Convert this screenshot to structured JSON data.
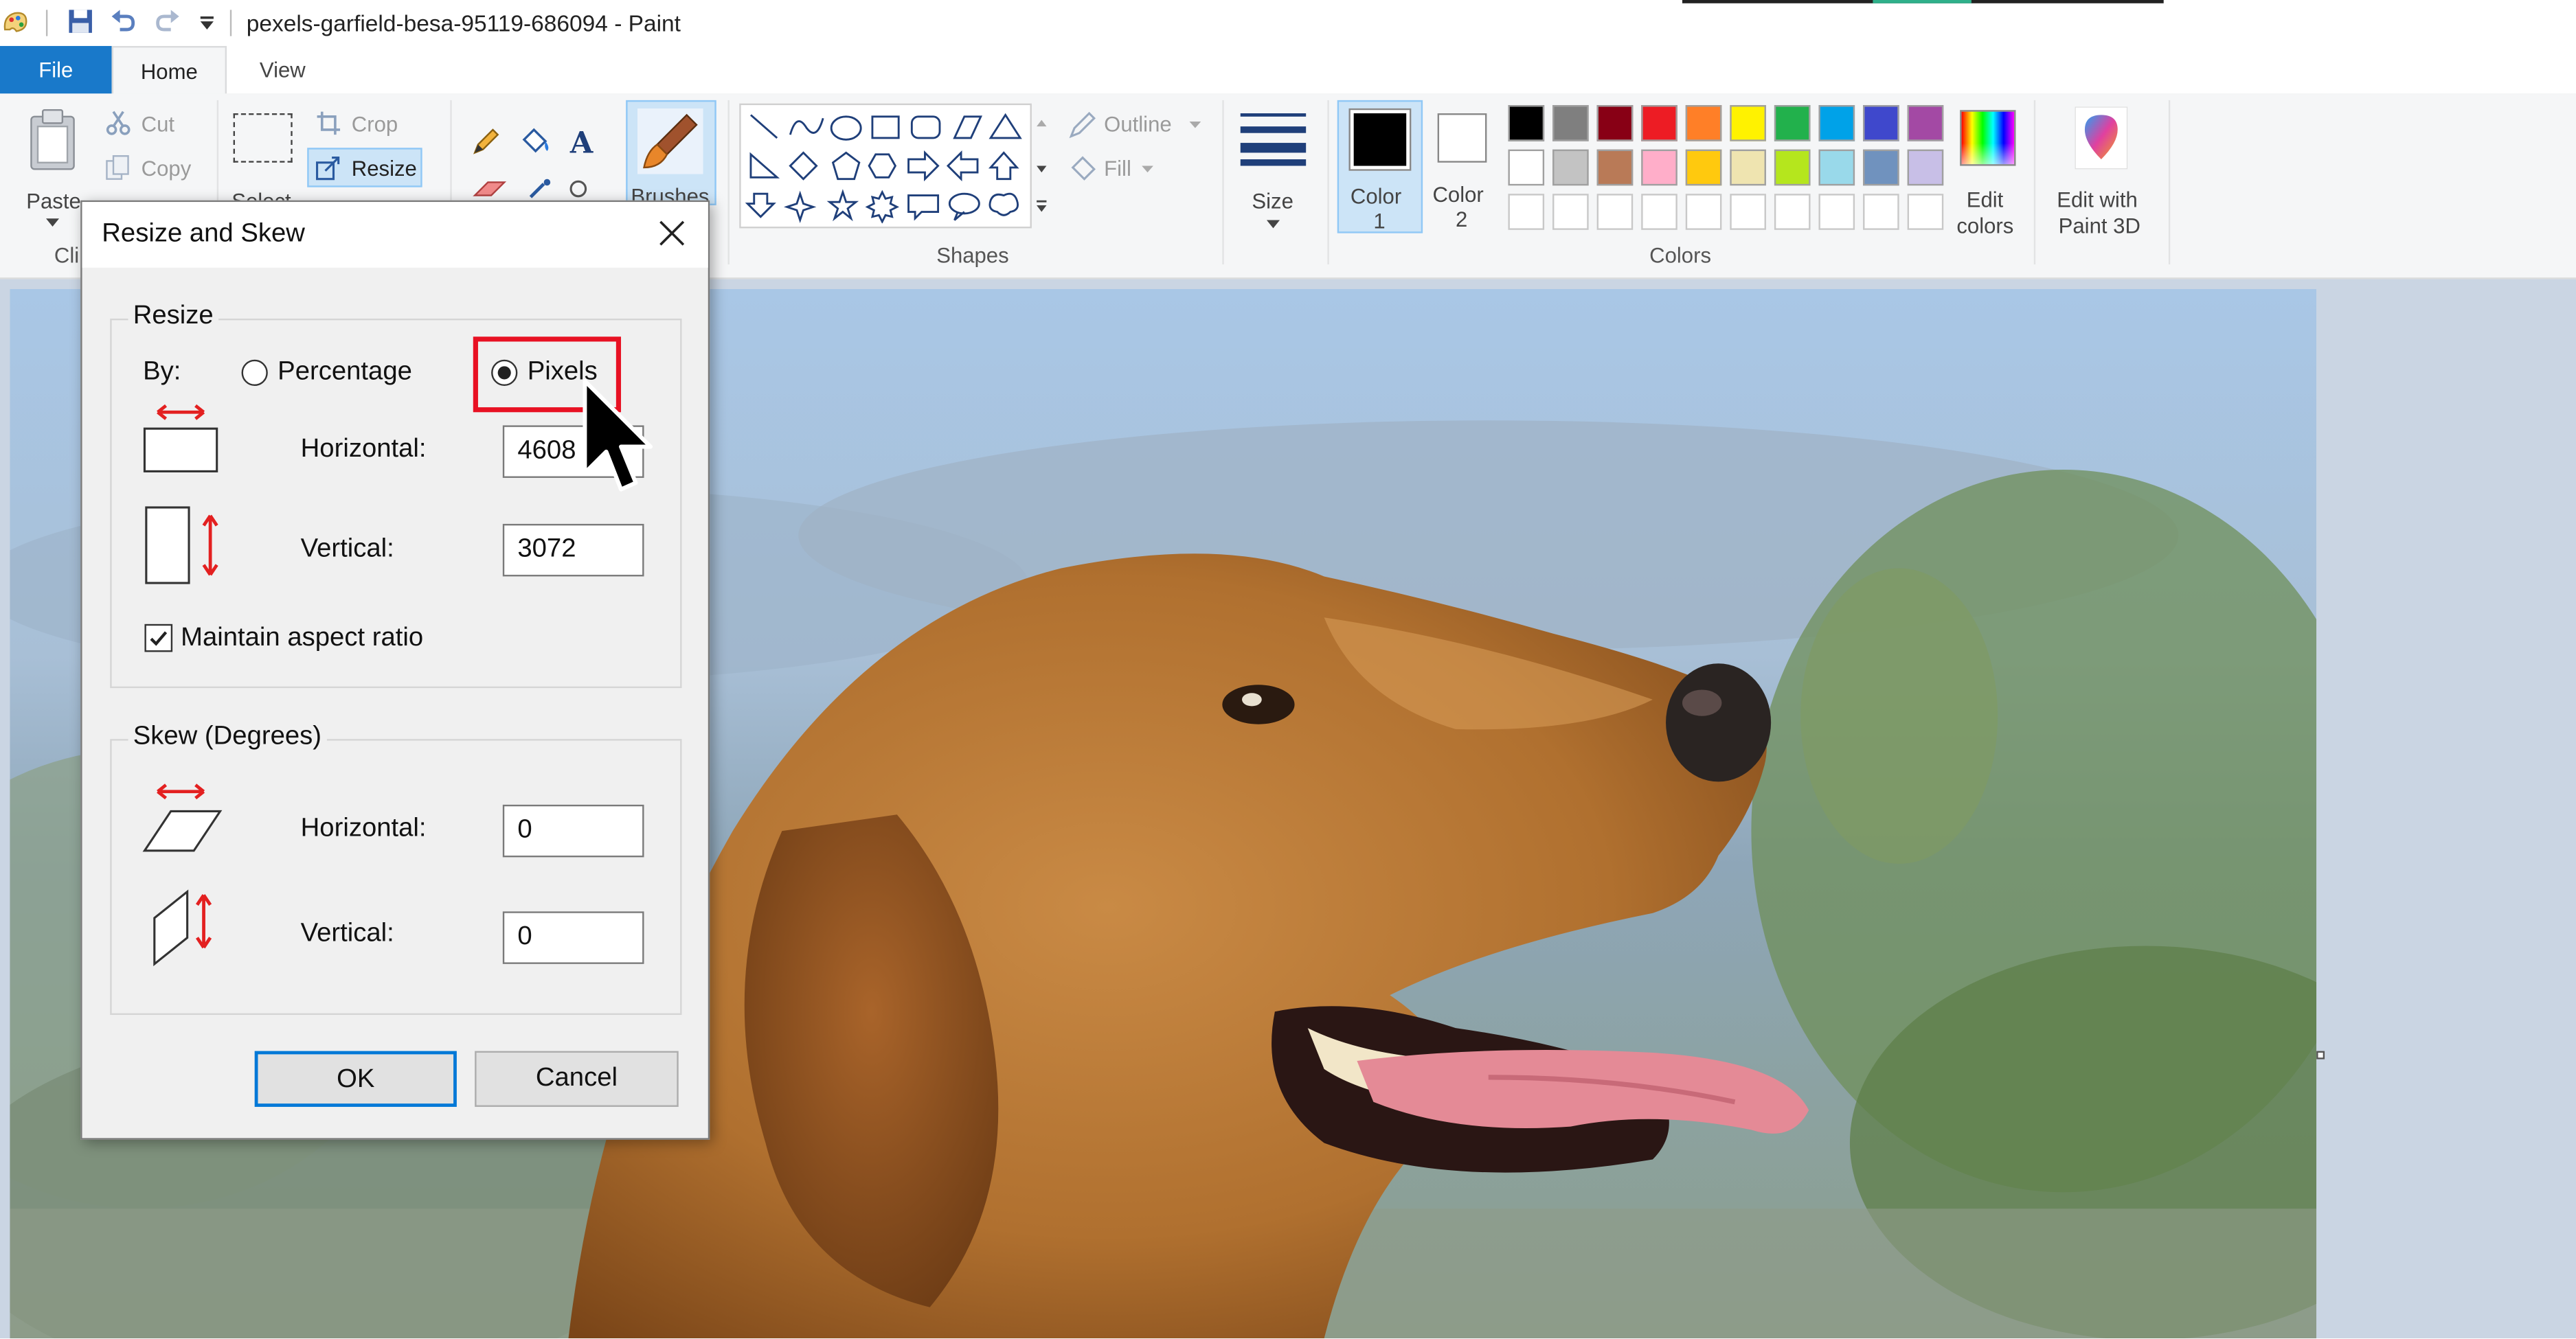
{
  "window": {
    "title": "pexels-garfield-besa-95119-686094 - Paint"
  },
  "tabs": [
    {
      "label": "File"
    },
    {
      "label": "Home"
    },
    {
      "label": "View"
    }
  ],
  "ribbon": {
    "clipboard": {
      "paste": "Paste",
      "cut": "Cut",
      "copy": "Copy",
      "group": "Cli"
    },
    "image": {
      "select": "Select",
      "crop": "Crop",
      "resize": "Resize"
    },
    "brushes": "Brushes",
    "shapes": {
      "group": "Shapes",
      "outline": "Outline",
      "fill": "Fill"
    },
    "size": "Size",
    "color1": {
      "line1": "Color",
      "line2": "1"
    },
    "color2": {
      "line1": "Color",
      "line2": "2"
    },
    "colors_group": "Colors",
    "edit_colors": {
      "line1": "Edit",
      "line2": "colors"
    },
    "paint3d": {
      "line1": "Edit with",
      "line2": "Paint 3D"
    },
    "palette": {
      "row1": [
        "#000000",
        "#7f7f7f",
        "#880015",
        "#ed1c24",
        "#ff7f27",
        "#fff200",
        "#22b14c",
        "#00a2e8",
        "#3f48cc",
        "#a349a4"
      ],
      "row2": [
        "#ffffff",
        "#c3c3c3",
        "#b97a57",
        "#ffaec9",
        "#ffc90e",
        "#efe4b0",
        "#b5e61d",
        "#99d9ea",
        "#7092be",
        "#c8bfe7"
      ],
      "row3": [
        "#ffffff",
        "#ffffff",
        "#ffffff",
        "#ffffff",
        "#ffffff",
        "#ffffff",
        "#ffffff",
        "#ffffff",
        "#ffffff",
        "#ffffff"
      ]
    }
  },
  "dialog": {
    "title": "Resize and Skew",
    "resize": {
      "legend": "Resize",
      "by_label": "By:",
      "percentage_label": "Percentage",
      "pixels_label": "Pixels",
      "selected": "Pixels",
      "horizontal_label": "Horizontal:",
      "horizontal_value": "4608",
      "vertical_label": "Vertical:",
      "vertical_value": "3072",
      "maintain_label": "Maintain aspect ratio",
      "maintain_checked": true
    },
    "skew": {
      "legend": "Skew (Degrees)",
      "horizontal_label": "Horizontal:",
      "horizontal_value": "0",
      "vertical_label": "Vertical:",
      "vertical_value": "0"
    },
    "ok": "OK",
    "cancel": "Cancel"
  },
  "colors": {
    "accent": "#1979ca",
    "highlight": "#e81123"
  }
}
